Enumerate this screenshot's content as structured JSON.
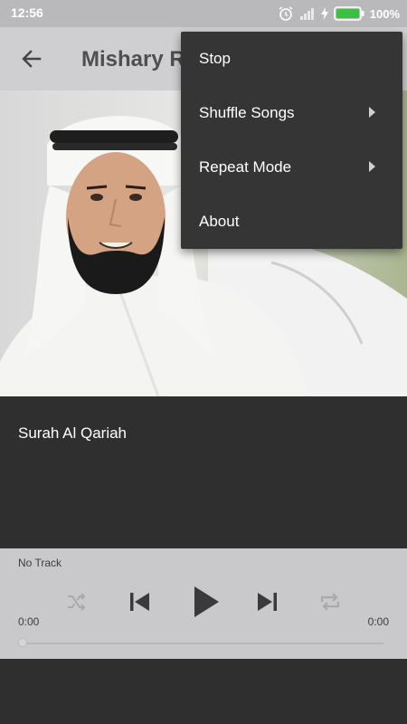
{
  "status_bar": {
    "time": "12:56",
    "battery_percent": "100%",
    "icons": [
      "alarm-icon",
      "signal-icon",
      "charging-icon",
      "battery-icon"
    ]
  },
  "app_bar": {
    "title": "Mishary R",
    "back_icon": "arrow-left-icon"
  },
  "now_playing": {
    "track_title": "Surah Al Qariah"
  },
  "player": {
    "status": "No Track",
    "elapsed": "0:00",
    "duration": "0:00",
    "progress": 0,
    "controls": [
      "shuffle-icon",
      "previous-icon",
      "play-icon",
      "next-icon",
      "repeat-icon"
    ]
  },
  "overflow_menu": {
    "items": [
      {
        "label": "Stop",
        "has_submenu": false
      },
      {
        "label": "Shuffle Songs",
        "has_submenu": true
      },
      {
        "label": "Repeat Mode",
        "has_submenu": true
      },
      {
        "label": "About",
        "has_submenu": false
      }
    ]
  },
  "colors": {
    "status_bar": "#b9b9bc",
    "app_bar": "#cfcfd1",
    "background": "#2f2f2f",
    "player": "#c9c9cc",
    "menu": "#353535",
    "battery": "#36c23a"
  }
}
